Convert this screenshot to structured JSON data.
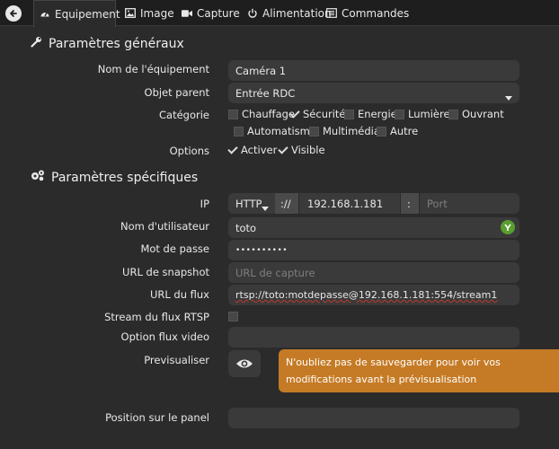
{
  "tabs": [
    {
      "label": "Equipement",
      "icon": "tachometer-icon"
    },
    {
      "label": "Image",
      "icon": "image-icon"
    },
    {
      "label": "Capture",
      "icon": "video-camera-icon"
    },
    {
      "label": "Alimentation",
      "icon": "power-icon"
    },
    {
      "label": "Commandes",
      "icon": "list-icon"
    }
  ],
  "general": {
    "title": "Paramètres généraux",
    "name_label": "Nom de l'équipement",
    "name_value": "Caméra 1",
    "parent_label": "Objet parent",
    "parent_value": "Entrée RDC",
    "category_label": "Catégorie",
    "categories": [
      {
        "label": "Chauffage",
        "checked": false
      },
      {
        "label": "Sécurité",
        "checked": true
      },
      {
        "label": "Energie",
        "checked": false
      },
      {
        "label": "Lumière",
        "checked": false
      },
      {
        "label": "Ouvrant",
        "checked": false
      },
      {
        "label": "Automatisme",
        "checked": false
      },
      {
        "label": "Multimédia",
        "checked": false
      },
      {
        "label": "Autre",
        "checked": false
      }
    ],
    "options_label": "Options",
    "options": [
      {
        "label": "Activer",
        "checked": true
      },
      {
        "label": "Visible",
        "checked": true
      }
    ]
  },
  "specific": {
    "title": "Paramètres spécifiques",
    "ip_label": "IP",
    "protocol_value": "HTTP",
    "separator": "://",
    "ip_value": "192.168.1.181",
    "colon": ":",
    "port_placeholder": "Port",
    "user_label": "Nom d'utilisateur",
    "user_value": "toto",
    "password_label": "Mot de passe",
    "password_value": "••••••••••",
    "snapshot_label": "URL de snapshot",
    "snapshot_placeholder": "URL de capture",
    "stream_label": "URL du flux",
    "stream_value": "rtsp://toto:motdepasse@192.168.1.181:554/stream1",
    "rtsp_label": "Stream du flux RTSP",
    "rtsp_checked": false,
    "video_option_label": "Option flux video",
    "video_option_value": "",
    "preview_label": "Previsualiser",
    "preview_notice": "N'oubliez pas de sauvegarder pour voir vos modifications avant la prévisualisation",
    "position_label": "Position sur le panel",
    "position_value": ""
  },
  "colors": {
    "background": "#2b2b2b",
    "field": "#3a3a3a",
    "notice": "#c57b25",
    "validation": "#5a9e2f"
  }
}
